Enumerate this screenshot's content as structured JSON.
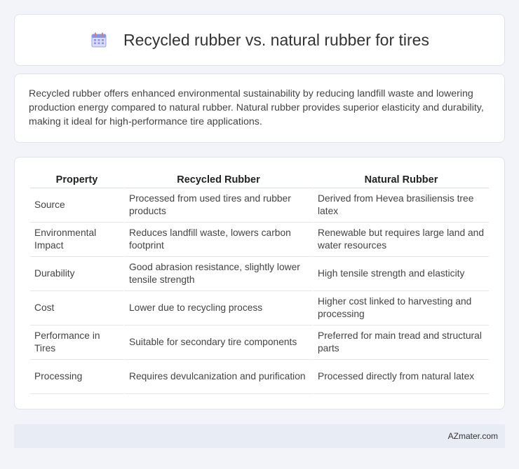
{
  "header": {
    "title": "Recycled rubber vs. natural rubber for tires",
    "icon": "calendar-icon"
  },
  "summary": {
    "text": "Recycled rubber offers enhanced environmental sustainability by reducing landfill waste and lowering production energy compared to natural rubber. Natural rubber provides superior elasticity and durability, making it ideal for high-performance tire applications."
  },
  "table": {
    "columns": [
      "Property",
      "Recycled Rubber",
      "Natural Rubber"
    ],
    "rows": [
      [
        "Source",
        "Processed from used tires and rubber products",
        "Derived from Hevea brasiliensis tree latex"
      ],
      [
        "Environmental Impact",
        "Reduces landfill waste, lowers carbon footprint",
        "Renewable but requires large land and water resources"
      ],
      [
        "Durability",
        "Good abrasion resistance, slightly lower tensile strength",
        "High tensile strength and elasticity"
      ],
      [
        "Cost",
        "Lower due to recycling process",
        "Higher cost linked to harvesting and processing"
      ],
      [
        "Performance in Tires",
        "Suitable for secondary tire components",
        "Preferred for main tread and structural parts"
      ],
      [
        "Processing",
        "Requires devulcanization and purification",
        "Processed directly from natural latex"
      ]
    ]
  },
  "footer": {
    "brand": "AZmater.com"
  }
}
